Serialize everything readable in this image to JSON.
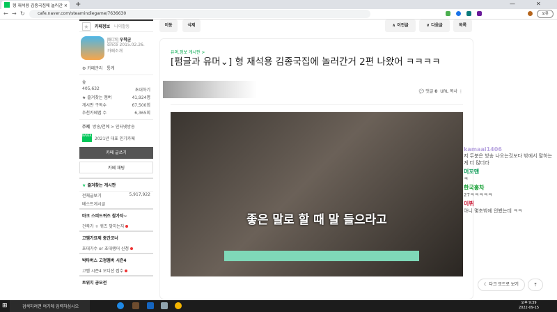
{
  "browser": {
    "tab_title": "형 재석용 김종국집에 놀러간",
    "url": "cafe.naver.com/steamindiegame/7636630",
    "profile_label": "오류"
  },
  "sidebar": {
    "tab_info": "카페정보",
    "tab_activity": "나의활동",
    "manager_label": "매니저",
    "manager_name": "우왁굳",
    "since": "since 2015.02.26.",
    "cafe_intro": "카페소개",
    "manage": "⚙ 카페관리",
    "stats": "통계",
    "level": "숲",
    "members": "405,632",
    "invite": "초대하기",
    "stats_rows": [
      {
        "label": "★ 즐겨찾는 멤버",
        "value": "41,924명"
      },
      {
        "label": "게시판 구독수",
        "value": "67,500회"
      },
      {
        "label": "추천카페맵 수",
        "value": "6,365회"
      }
    ],
    "topic_label": "주제",
    "topic": "방송/연예 > 인터넷방송",
    "naver_badge": "NAVER 대표카페",
    "award": "2021년 대표 인기카페",
    "write_btn": "카페 글쓰기",
    "chat_btn": "카페 채팅",
    "fav_boards": "즐겨찾는 게시판",
    "all_posts": "전체글보기",
    "all_count": "5,917,922",
    "best": "베스트게시글",
    "groups": [
      {
        "title": "마크 스피드퀴즈 참가자~",
        "item": "건축가 + 퀴즈 맞히는자"
      },
      {
        "title": "고멤가요제 중간코너",
        "item": "초대가수 or 초대랭어 신청"
      },
      {
        "title": "박타버스 고정멤버 시즌4",
        "item": "고멤 시즌4 오디션 접수"
      }
    ],
    "more": "트위치 공모전"
  },
  "toolbar": {
    "move": "이동",
    "delete": "삭제",
    "prev": "∧ 이전글",
    "next": "∨ 다음글",
    "list": "목록"
  },
  "post": {
    "board": "유머,정보 게시판 >",
    "title": "[펌글과 유머⌄] 형 재석용 김종국집에 놀러간거 2편 나왔어 ㅋㅋㅋㅋ",
    "comments_label": "댓글",
    "comments": "0",
    "url_copy": "URL 복사",
    "subtitle": "좋은 말로 할 때 말 들으라고"
  },
  "chat": [
    {
      "nick": "kamaai1406",
      "msg": "저 두분은 방송 나오는것보다 밖에서 말하는게 더 많더라",
      "color": "#b9a6e0"
    },
    {
      "nick": "머꼬맨",
      "msg": "ㅋ",
      "color": "#0a9a55"
    },
    {
      "nick": "한국홍차",
      "msg": "27ㅋㅋㅋㅋㅋ",
      "color": "#0a9a2a"
    },
    {
      "nick": "이뷔",
      "msg": "아니 몇초밖에 안봤는데 ㅋㅋ",
      "color": "#c8102e"
    }
  ],
  "dark_mode": "다크 모드로 보기",
  "taskbar": {
    "search": "검색하려면 여기에 입력하십시오",
    "time": "오후 9:39",
    "date": "2022-09-15"
  }
}
